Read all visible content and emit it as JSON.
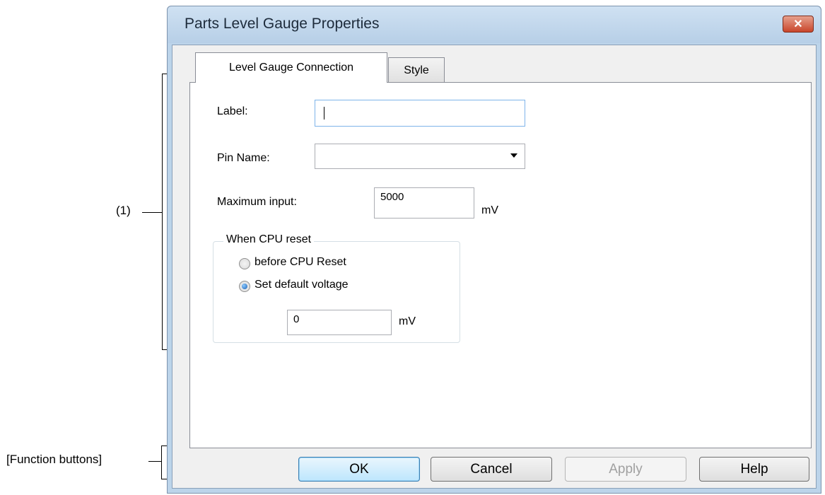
{
  "annotations": {
    "region_1": "(1)",
    "function_buttons": "[Function buttons]"
  },
  "window": {
    "title": "Parts Level Gauge Properties",
    "close_symbol": "✕"
  },
  "tabs": [
    {
      "label": "Level Gauge Connection",
      "active": true
    },
    {
      "label": "Style",
      "active": false
    }
  ],
  "form": {
    "label_caption": "Label:",
    "label_value": "",
    "pin_name_caption": "Pin Name:",
    "pin_name_value": "",
    "max_input_caption": "Maximum input:",
    "max_input_value": "5000",
    "max_input_unit": "mV"
  },
  "cpu_reset_group": {
    "title": "When CPU reset",
    "option_before": "before CPU Reset",
    "option_default": "Set default voltage",
    "selected": "Set default voltage",
    "default_voltage_value": "0",
    "default_voltage_unit": "mV"
  },
  "buttons": {
    "ok": "OK",
    "cancel": "Cancel",
    "apply": "Apply",
    "help": "Help"
  },
  "colors": {
    "window_frame": "#bcd4ea",
    "close_button": "#c9462b",
    "default_button": "#bde6fd"
  }
}
